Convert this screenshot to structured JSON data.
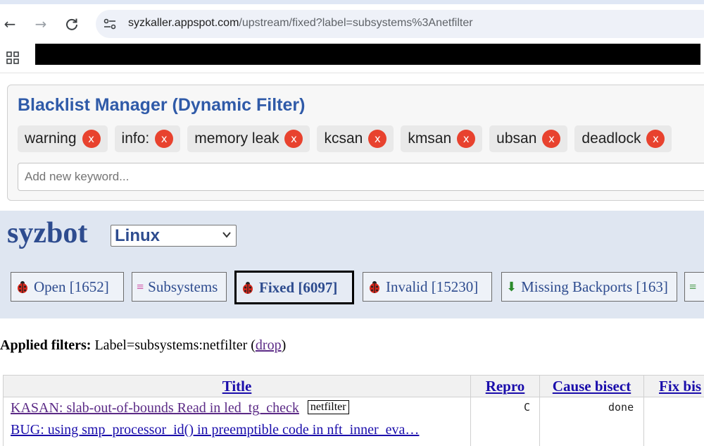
{
  "browser": {
    "url_host": "syzkaller.appspot.com",
    "url_path": "/upstream/fixed?label=subsystems%3Anetfilter"
  },
  "blacklist": {
    "title": "Blacklist Manager (Dynamic Filter)",
    "keywords": [
      "warning",
      "info:",
      "memory leak",
      "kcsan",
      "kmsan",
      "ubsan",
      "deadlock"
    ],
    "remove_label": "x",
    "input_placeholder": "Add new keyword..."
  },
  "header": {
    "logo": "syzbot",
    "namespace": "Linux",
    "tabs": [
      {
        "label": "Open [1652]",
        "icon": "ladybug-icon"
      },
      {
        "label": "Subsystems",
        "icon": "list-lines-icon"
      },
      {
        "label": "Fixed [6097]",
        "icon": "ladybug-icon",
        "active": true
      },
      {
        "label": "Invalid [15230]",
        "icon": "ladybug-icon"
      },
      {
        "label": "Missing Backports [163]",
        "icon": "down-arrow-icon"
      },
      {
        "label": "",
        "icon": "list-lines-icon"
      }
    ]
  },
  "filters": {
    "prefix": "Applied filters:",
    "value": "Label=subsystems:netfilter",
    "drop_label": "drop"
  },
  "table": {
    "headers": [
      "Title",
      "Repro",
      "Cause bisect",
      "Fix bis"
    ],
    "rows": [
      {
        "title": "KASAN: slab-out-of-bounds Read in led_tg_check",
        "tag": "netfilter",
        "repro": "C",
        "cause_bisect": "done"
      },
      {
        "title": "BUG: using smp_processor_id() in preemptible code in nft_inner_eva…",
        "tag": "",
        "repro": "",
        "cause_bisect": ""
      }
    ]
  },
  "colors": {
    "accent": "#2e4c8f",
    "band": "#dfe6f1",
    "chip_remove": "#e8422e",
    "link": "#1a0dab",
    "visited": "#5b2a86"
  }
}
